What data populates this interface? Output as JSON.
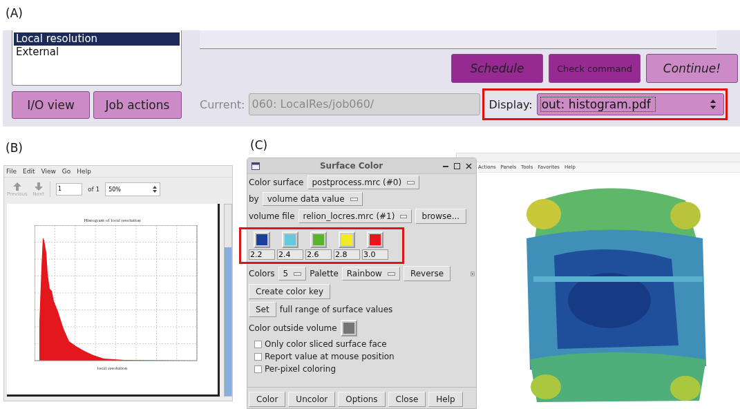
{
  "panel_a": {
    "label": "(A)",
    "job_types": [
      {
        "label": "Local resolution",
        "selected": true
      },
      {
        "label": "External",
        "selected": false
      }
    ],
    "run_buttons": [
      {
        "label": "Schedule",
        "kind": "dark",
        "italic": true
      },
      {
        "label": "Check command",
        "kind": "dark",
        "italic": false
      },
      {
        "label": "Continue!",
        "kind": "light",
        "italic": true
      }
    ],
    "view_buttons": [
      "I/O view",
      "Job actions"
    ],
    "current": {
      "label": "Current:",
      "value": "060: LocalRes/job060/",
      "disabled": true
    },
    "display": {
      "label": "Display:",
      "value": "out: histogram.pdf",
      "highlighted": true
    }
  },
  "panel_b": {
    "label": "(B)",
    "menu": [
      "File",
      "Edit",
      "View",
      "Go",
      "Help"
    ],
    "toolbar": [
      {
        "label": "Previous",
        "disabled": true
      },
      {
        "label": "Next",
        "disabled": true
      }
    ],
    "page": "1",
    "page_count": "of 1",
    "zoom": "50%",
    "histogram": {
      "title": "Histogram of local resolution",
      "xlabel": "local resolution"
    }
  },
  "panel_c": {
    "label": "(C)",
    "viewer_menu": [
      "Actions",
      "Panels",
      "Tools",
      "Favorites",
      "Help"
    ],
    "dialog": {
      "title": "Surface Color",
      "color_surface_label": "Color surface",
      "color_surface": "postprocess.mrc (#0)",
      "by_label": "by",
      "by": "volume data value",
      "volume_file_label": "volume file",
      "volume_file": "relion_locres.mrc (#1)",
      "browse": "browse...",
      "swatches": [
        {
          "color": "#1b3f9c",
          "value": "2.2"
        },
        {
          "color": "#63c9dc",
          "value": "2.4"
        },
        {
          "color": "#58b42c",
          "value": "2.6"
        },
        {
          "color": "#f2ea22",
          "value": "2.8"
        },
        {
          "color": "#e8161c",
          "value": "3.0"
        }
      ],
      "highlighted": true,
      "colors_label": "Colors",
      "colors": "5",
      "palette_label": "Palette",
      "palette": "Rainbow",
      "reverse": "Reverse",
      "create_key": "Create color key",
      "set": "Set",
      "set_text": "full range of surface values",
      "outside_label": "Color outside volume",
      "options": [
        {
          "label": "Only color sliced surface face",
          "checked": false
        },
        {
          "label": "Report value at mouse position",
          "checked": false
        },
        {
          "label": "Per-pixel coloring",
          "checked": false
        }
      ],
      "buttons": [
        "Color",
        "Uncolor",
        "Options",
        "Close",
        "Help"
      ]
    }
  }
}
